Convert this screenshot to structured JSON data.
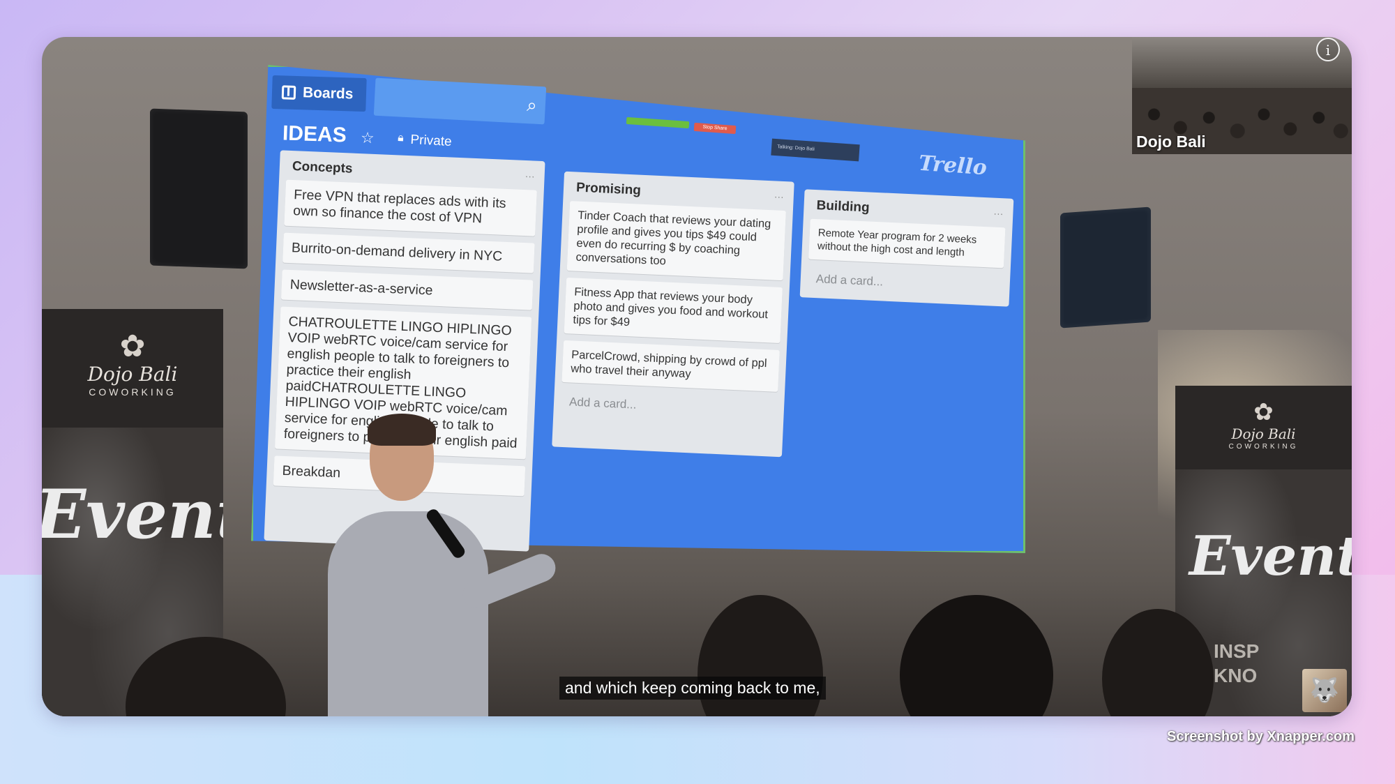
{
  "video": {
    "caption": "and which keep coming back to me,",
    "camera_tile_label": "Dojo Bali",
    "info_icon": "i"
  },
  "trello": {
    "boards_button": "Boards",
    "board_title": "IDEAS",
    "visibility": "Private",
    "logo": "Trello",
    "stop_share": "Stop Share",
    "talking": "Talking: Dojo Bali",
    "lists": [
      {
        "title": "Concepts",
        "cards": [
          "Free VPN that replaces ads with its own so finance the cost of VPN",
          "Burrito-on-demand delivery in NYC",
          "Newsletter-as-a-service",
          "CHATROULETTE LINGO HIPLINGO VOIP webRTC voice/cam service for english people to talk to foreigners to practice their english paidCHATROULETTE LINGO HIPLINGO VOIP webRTC voice/cam service for english people to talk to foreigners to practice their english paid",
          "Breakdan"
        ]
      },
      {
        "title": "Promising",
        "cards": [
          "Tinder Coach that reviews your dating profile and gives you tips $49 could even do recurring $ by coaching conversations too",
          "Fitness App that reviews your body photo and gives you food and workout tips for $49",
          "ParcelCrowd, shipping by crowd of ppl who travel their anyway"
        ],
        "add_card": "Add a card..."
      },
      {
        "title": "Building",
        "cards": [
          "Remote Year program for 2 weeks without the high cost and length"
        ],
        "add_card": "Add a card..."
      }
    ]
  },
  "banners": {
    "brand": "Dojo Bali",
    "sub": "COWORKING",
    "events": "Events",
    "events_prefix": "Dojo",
    "right_words": [
      "INSP",
      "KNO"
    ]
  },
  "watermark": "Screenshot by Xnapper.com"
}
